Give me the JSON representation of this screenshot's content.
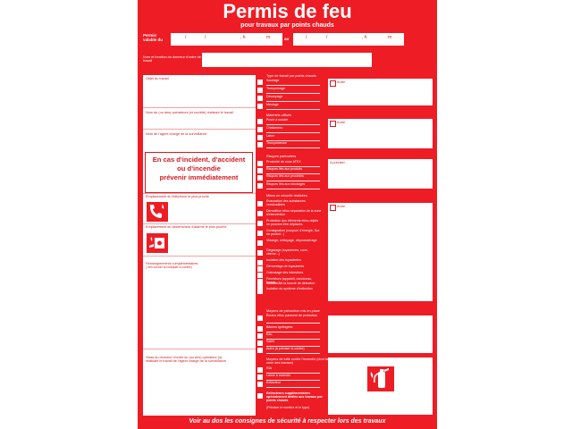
{
  "header": {
    "title": "Permis de feu",
    "subtitle": "pour travaux par points chauds"
  },
  "validity": {
    "label": "Permis valable du",
    "from": [
      "/",
      "/",
      ", h",
      "m"
    ],
    "to_label": "au",
    "to": [
      "/",
      "/",
      ", h",
      "m"
    ]
  },
  "requester": {
    "label": "Nom et fonction du donneur d'ordre de travail"
  },
  "left_col": {
    "object_label": "Objet du travail",
    "operators_label": "Nom du (ou des) opérateurs (et société) réalisant le travail",
    "supervisor_label": "Nom de l'agent chargé de la surveillance",
    "emergency": {
      "line1": "En cas d'incident, d'accident",
      "line2": "ou d'incendie",
      "line3": "prévenir immédiatement"
    },
    "phone_label": "Emplacement du téléphone le plus proche",
    "alarm_label": "Emplacement du déclencheur d'alarme le plus proche",
    "info_label": "Renseignements complémentaires",
    "info_sub": "( rien cocher ou indiquer ci-contre)",
    "visa_label": "Visas du donneur d'ordre du (ou des) opérateur (s) réalisant le travail de l'agent chargé de la surveillance"
  },
  "right_col": {
    "work_type": {
      "title": "Type de travail par points chauds",
      "options": [
        "Soudage",
        "Tronçonnage",
        "Découpage",
        "Meulage"
      ],
      "other": "Autre"
    },
    "materials": {
      "title": "Matériels utilisés",
      "options": [
        "Poste à souder",
        "Chalumeau",
        "Laser",
        "Tronçonneuse"
      ],
      "other": "Autre"
    },
    "risks": {
      "title": "Risques particuliers",
      "options": [
        "Proximité de zone ATEX",
        "Risques liés aux produits",
        "Risques liés aux procédés",
        "Risques liés aux stockages"
      ],
      "specify": "A préciser"
    },
    "safety_steps": {
      "title": "Mises en sécurité réalisées",
      "options": [
        "Évacuation des substances combustibles",
        "Démolition et/ou séparation de la zone d'intervention",
        "Protection des éléments et/ou objets ne pouvant être déplacés",
        "Consignation (coupure d'énergie, flux de produit...)",
        "Vidange, nettoyage, dépoussiérage",
        "Dégazage (tuyauteries, cuve, citerne...)",
        "Isolation des tuyauteries",
        "Démontage de tuyauteries",
        "Colmatage des interstices",
        "Fermeture (appareil, canniveau, fosses...)",
        "Isolation de la boucle de détection",
        "Isolation du système d'extinction"
      ],
      "other": "Autre"
    },
    "prevention": {
      "title": "Moyens de prévention mis en place",
      "options": [
        "Écrans et/ou paravent de protection",
        "Bâches ignifugées",
        "Eau",
        "Sable",
        "Autre (à préciser ci-contre)"
      ]
    },
    "fire_means": {
      "title": "Moyens de lutte contre l'incendie (dont la zone des travaux)",
      "options": [
        "RIA",
        "Lance à incendie",
        "Extincteur"
      ],
      "extra_bold": "Extincteurs supplémentaires spécialement dédiés aux travaux par points chauds",
      "extra_note": "(Préciser le nombre et le type)"
    }
  },
  "footer": {
    "text": "Voir au dos les consignes de sécurité à respecter lors des travaux"
  },
  "colors": {
    "sheet": "#ee1c25",
    "dark_text": "#d41820",
    "paper": "#ffffff"
  },
  "icons": [
    "phone-fire-icon",
    "fire-alarm-icon",
    "fire-extinguisher-icon"
  ]
}
